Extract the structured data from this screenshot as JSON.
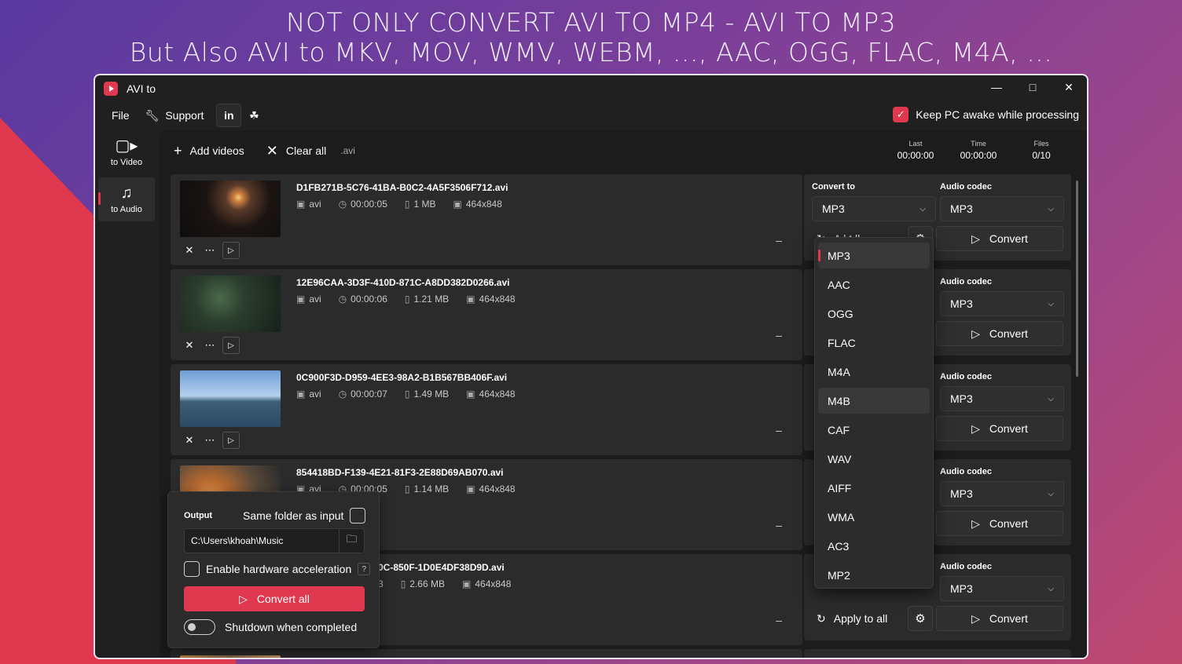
{
  "banner": {
    "line1": "NOT ONLY CONVERT AVI TO MP4 - AVI TO MP3",
    "line2": "But Also AVI to MKV, MOV, WMV, WEBM, ..., AAC, OGG, FLAC, M4A, ..."
  },
  "window": {
    "title": "AVI to",
    "minimize_glyph": "—",
    "maximize_glyph": "□",
    "close_glyph": "✕"
  },
  "menu": {
    "file": "File",
    "support": "Support",
    "linkedin": "in",
    "keep_awake": "Keep PC awake while processing"
  },
  "sidebar": {
    "items": [
      {
        "label": "to Video",
        "icon": "video-camera-icon"
      },
      {
        "label": "to Audio",
        "icon": "music-note-icon"
      }
    ]
  },
  "toolbar": {
    "add_videos": "Add videos",
    "clear_all": "Clear all",
    "extension": ".avi"
  },
  "stats": {
    "last_label": "Last",
    "last_value": "00:00:00",
    "time_label": "Time",
    "time_value": "00:00:00",
    "files_label": "Files",
    "files_value": "0/10"
  },
  "files": [
    {
      "name": "D1FB271B-5C76-41BA-B0C2-4A5F3506F712.avi",
      "format": "avi",
      "duration": "00:00:05",
      "size": "1 MB",
      "resolution": "464x848"
    },
    {
      "name": "12E96CAA-3D3F-410D-871C-A8DD382D0266.avi",
      "format": "avi",
      "duration": "00:00:06",
      "size": "1.21 MB",
      "resolution": "464x848"
    },
    {
      "name": "0C900F3D-D959-4EE3-98A2-B1B567BB406F.avi",
      "format": "avi",
      "duration": "00:00:07",
      "size": "1.49 MB",
      "resolution": "464x848"
    },
    {
      "name": "854418BD-F139-4E21-81F3-2E88D69AB070.avi",
      "format": "avi",
      "duration": "00:00:05",
      "size": "1.14 MB",
      "resolution": "464x848"
    },
    {
      "name": "0C-850F-1D0E4DF38D9D.avi",
      "format": "",
      "duration": "3",
      "size": "2.66 MB",
      "resolution": "464x848"
    }
  ],
  "convert_panel": {
    "convert_to_label": "Convert to",
    "audio_codec_label": "Audio codec",
    "format_value": "MP3",
    "codec_value": "MP3",
    "convert_label": "Convert",
    "apply_to_all": "Apply to all",
    "apply_partial": "A    l  t   ll"
  },
  "dropdown": {
    "options": [
      "MP3",
      "AAC",
      "OGG",
      "FLAC",
      "M4A",
      "M4B",
      "CAF",
      "WAV",
      "AIFF",
      "WMA",
      "AC3",
      "MP2"
    ],
    "selected": "MP3",
    "hovered": "M4B"
  },
  "output": {
    "label": "Output",
    "same_folder": "Same folder as input",
    "path": "C:\\Users\\khoah\\Music",
    "hw_accel": "Enable hardware acceleration",
    "help": "?",
    "convert_all": "Convert all",
    "shutdown": "Shutdown when completed"
  },
  "colors": {
    "accent": "#e0384e",
    "window_bg": "#202020",
    "card_bg": "#2b2b2b"
  }
}
